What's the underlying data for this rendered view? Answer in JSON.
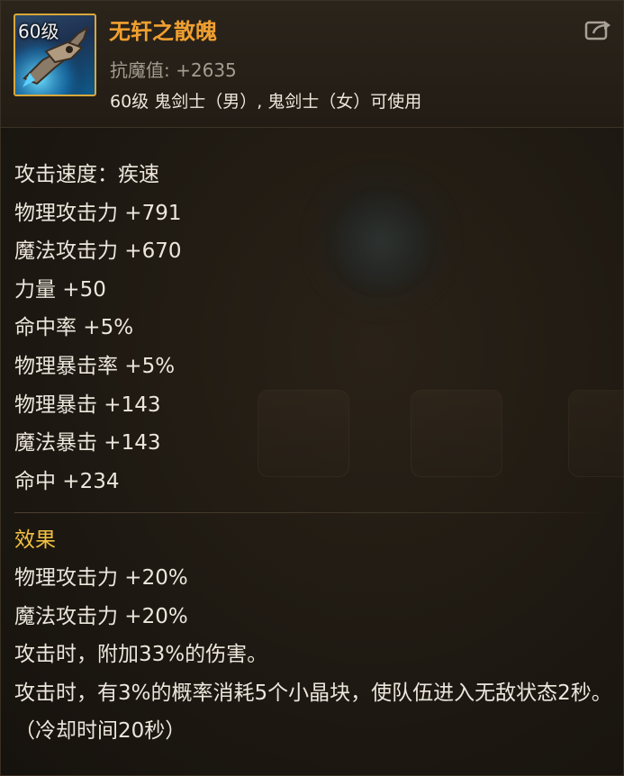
{
  "item": {
    "level_tag": "60级",
    "name": "无轩之散魄",
    "resist_label": "抗魔值:",
    "resist_value": "+2635",
    "usable_by": "60级 鬼剑士（男）, 鬼剑士（女）可使用",
    "share_icon": "share-export-icon"
  },
  "stats": [
    "攻击速度：疾速",
    "物理攻击力 +791",
    "魔法攻击力 +670",
    "力量 +50",
    "命中率 +5%",
    "物理暴击率 +5%",
    "物理暴击 +143",
    "魔法暴击 +143",
    "命中 +234"
  ],
  "effects": {
    "title": "效果",
    "lines": [
      "物理攻击力 +20%",
      "魔法攻击力 +20%",
      "攻击时，附加33%的伤害。",
      "攻击时，有3%的概率消耗5个小晶块，使队伍进入无敌状态2秒。（冷却时间20秒）"
    ]
  },
  "colors": {
    "name": "#f0a030",
    "effect_title": "#f0c040",
    "text": "#ece6dc",
    "sub_text": "#a59c90",
    "icon_border": "#d8a83a"
  }
}
